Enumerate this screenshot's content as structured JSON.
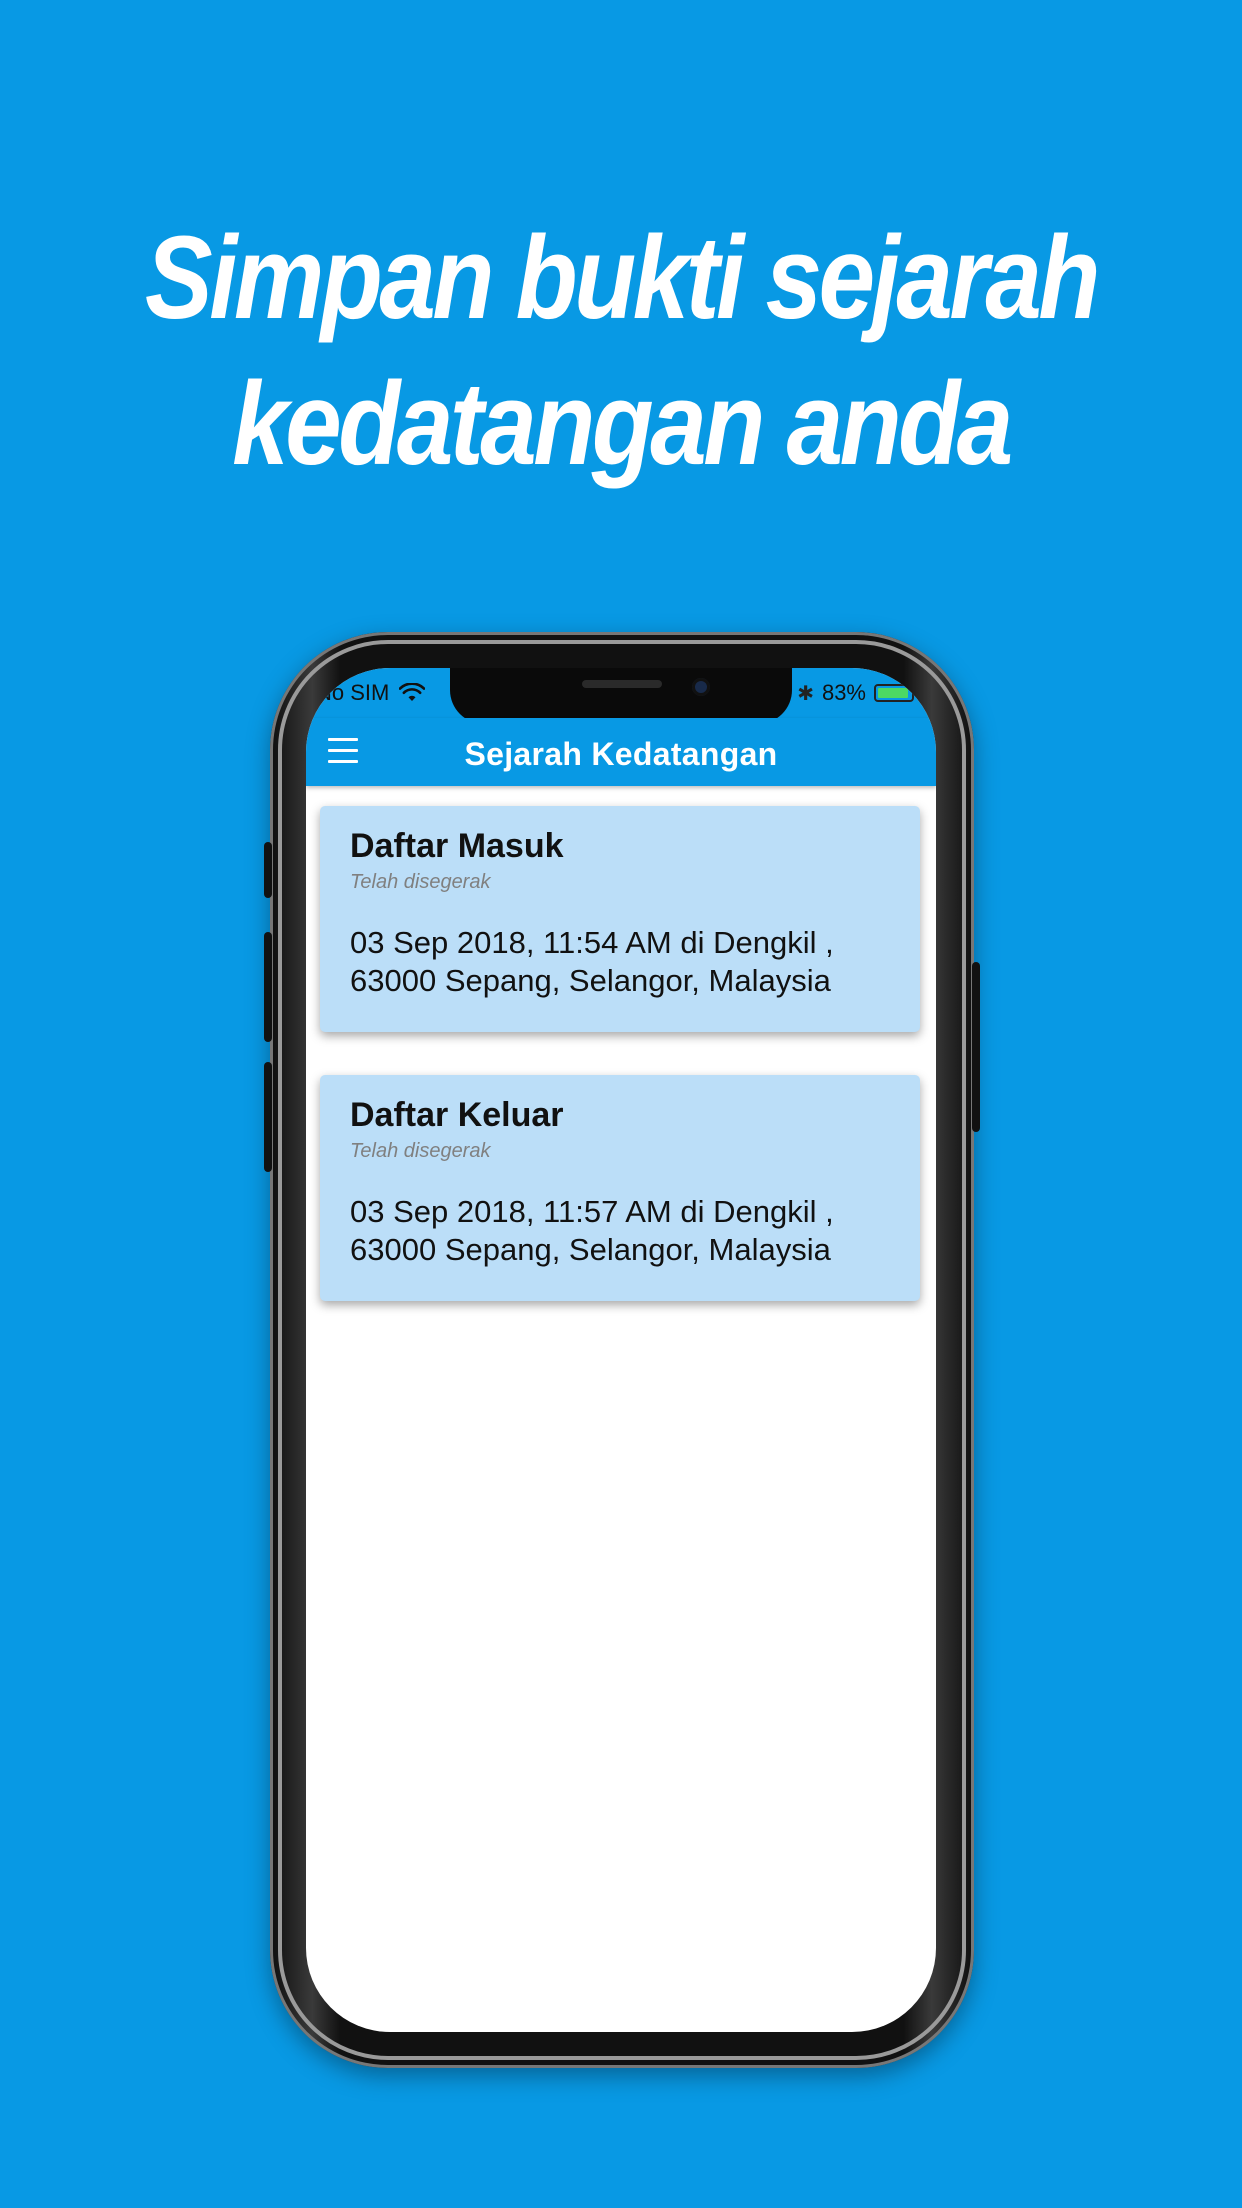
{
  "headline": {
    "line1": "Simpan bukti sejarah",
    "line2": "kedatangan anda"
  },
  "status_bar": {
    "carrier": "No SIM",
    "wifi_icon": "wifi-icon",
    "bluetooth_icon": "bluetooth-icon",
    "battery_percent": "83%",
    "battery_level": 0.83
  },
  "app_bar": {
    "menu_icon": "hamburger-menu-icon",
    "title": "Sejarah Kedatangan"
  },
  "records": [
    {
      "title": "Daftar Masuk",
      "status": "Telah disegerak",
      "detail_line1": "03 Sep 2018, 11:54 AM di   Dengkil ,",
      "detail_line2": "63000 Sepang, Selangor, Malaysia"
    },
    {
      "title": "Daftar Keluar",
      "status": "Telah disegerak",
      "detail_line1": "03 Sep 2018, 11:57 AM di   Dengkil ,",
      "detail_line2": "63000 Sepang, Selangor, Malaysia"
    }
  ],
  "colors": {
    "background": "#0899E4",
    "app_bar": "#0899E4",
    "card": "#BBDEF8",
    "screen": "#FFFFFF",
    "battery_fill": "#4CD964"
  }
}
